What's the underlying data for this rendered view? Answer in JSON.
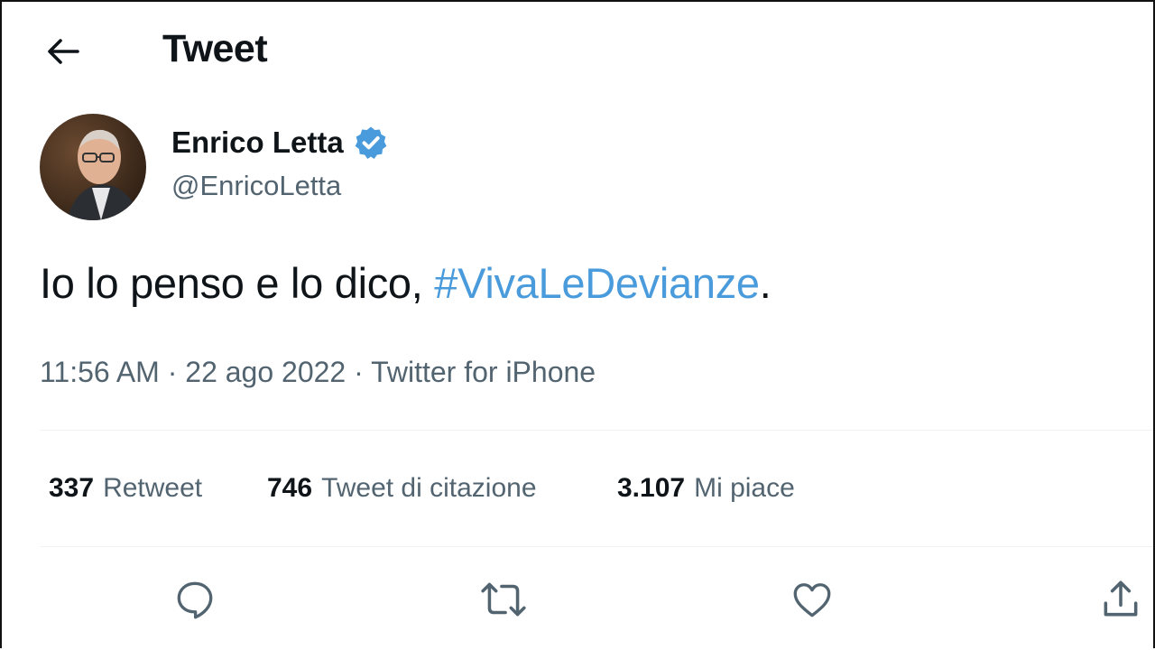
{
  "header": {
    "title": "Tweet",
    "back_icon": "arrow-left-icon"
  },
  "author": {
    "display_name": "Enrico Letta",
    "handle": "@EnricoLetta",
    "verified": true,
    "verified_color": "#1d9bf0",
    "avatar_icon": "profile-photo"
  },
  "tweet": {
    "text_before": "Io lo penso e lo dico, ",
    "hashtag": "#VivaLeDevianze",
    "text_after": ".",
    "time": "11:56 AM",
    "separator": "·",
    "date": "22 ago 2022",
    "source": "Twitter for iPhone"
  },
  "stats": [
    {
      "count": "337",
      "label": "Retweet"
    },
    {
      "count": "746",
      "label": "Tweet di citazione"
    },
    {
      "count": "3.107",
      "label": "Mi piace"
    }
  ],
  "actions": {
    "reply_icon": "reply-bubble-icon",
    "retweet_icon": "retweet-icon",
    "like_icon": "heart-icon",
    "share_icon": "share-icon"
  },
  "colors": {
    "link": "#4a9bdc",
    "secondary_text": "#536471",
    "primary_text": "#0f1419"
  }
}
